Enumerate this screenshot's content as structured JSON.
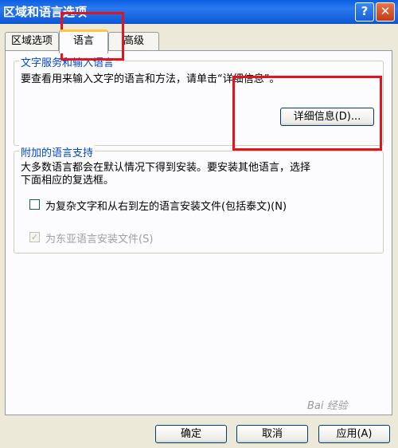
{
  "window": {
    "title": "区域和语言选项",
    "help_glyph": "?",
    "close_glyph": "✕"
  },
  "tabs": [
    {
      "label": "区域选项"
    },
    {
      "label": "语言"
    },
    {
      "label": "高级"
    }
  ],
  "text_services": {
    "legend": "文字服务和输入语言",
    "description": "要查看用来输入文字的语言和方法，请单击“详细信息”。",
    "details_button": "详细信息(D)..."
  },
  "supplemental": {
    "legend": "附加的语言支持",
    "description": "大多数语言都会在默认情况下得到安装。要安装其他语言，选择\n下面相应的复选框。",
    "complex_script": {
      "label": "为复杂文字和从右到左的语言安装文件(包括泰文)(N)",
      "checked": false
    },
    "east_asian": {
      "label": "为东亚语言安装文件(S)",
      "checked": true,
      "disabled": true
    }
  },
  "footer": {
    "ok": "确定",
    "cancel": "取消",
    "apply": "应用(A)"
  },
  "watermark": "Bai 经验"
}
